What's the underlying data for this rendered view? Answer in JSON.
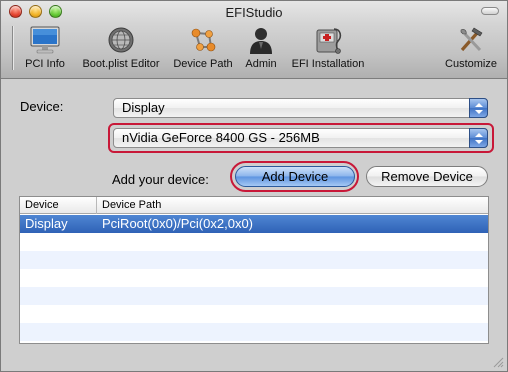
{
  "window": {
    "title": "EFIStudio"
  },
  "toolbar": {
    "items": [
      {
        "label": "PCI Info",
        "icon": "monitor-icon"
      },
      {
        "label": "Boot.plist Editor",
        "icon": "gear-globe-icon"
      },
      {
        "label": "Device Path",
        "icon": "molecule-icon"
      },
      {
        "label": "Admin",
        "icon": "admin-person-icon"
      },
      {
        "label": "EFI Installation",
        "icon": "medical-kit-icon"
      },
      {
        "label": "Customize",
        "icon": "tools-icon"
      }
    ]
  },
  "form": {
    "device_label": "Device:",
    "device_select": "Display",
    "model_select": "nVidia GeForce 8400 GS - 256MB",
    "add_label": "Add your device:",
    "add_button": "Add Device",
    "remove_button": "Remove Device"
  },
  "table": {
    "headers": [
      "Device",
      "Device Path"
    ],
    "rows": [
      {
        "device": "Display",
        "path": "PciRoot(0x0)/Pci(0x2,0x0)"
      }
    ]
  },
  "colors": {
    "highlight_ring": "#c81838",
    "selection": "#3a6fc0",
    "accent": "#5b8bd4"
  }
}
